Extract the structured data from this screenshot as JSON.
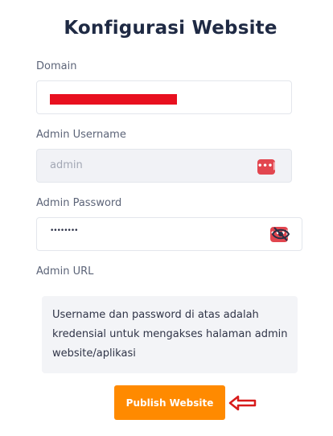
{
  "title": "Konfigurasi Website",
  "fields": {
    "domain": {
      "label": "Domain",
      "value": ""
    },
    "admin_username": {
      "label": "Admin Username",
      "value": "admin"
    },
    "admin_password": {
      "label": "Admin Password",
      "value": "••••••••"
    },
    "admin_url": {
      "label": "Admin URL"
    }
  },
  "note": "Username dan password di atas adalah kredensial untuk mengakses halaman admin website/aplikasi",
  "publish_button": "Publish Website",
  "icons": {
    "username_addon": "password-manager-icon",
    "password_addon": "password-manager-icon",
    "visibility_toggle": "eye-slash-icon",
    "annotation": "red-arrow-left-icon"
  },
  "colors": {
    "accent": "#ff8a00",
    "redaction": "#e8101f",
    "addon_icon": "#e2464f",
    "arrow": "#d81b1b"
  }
}
